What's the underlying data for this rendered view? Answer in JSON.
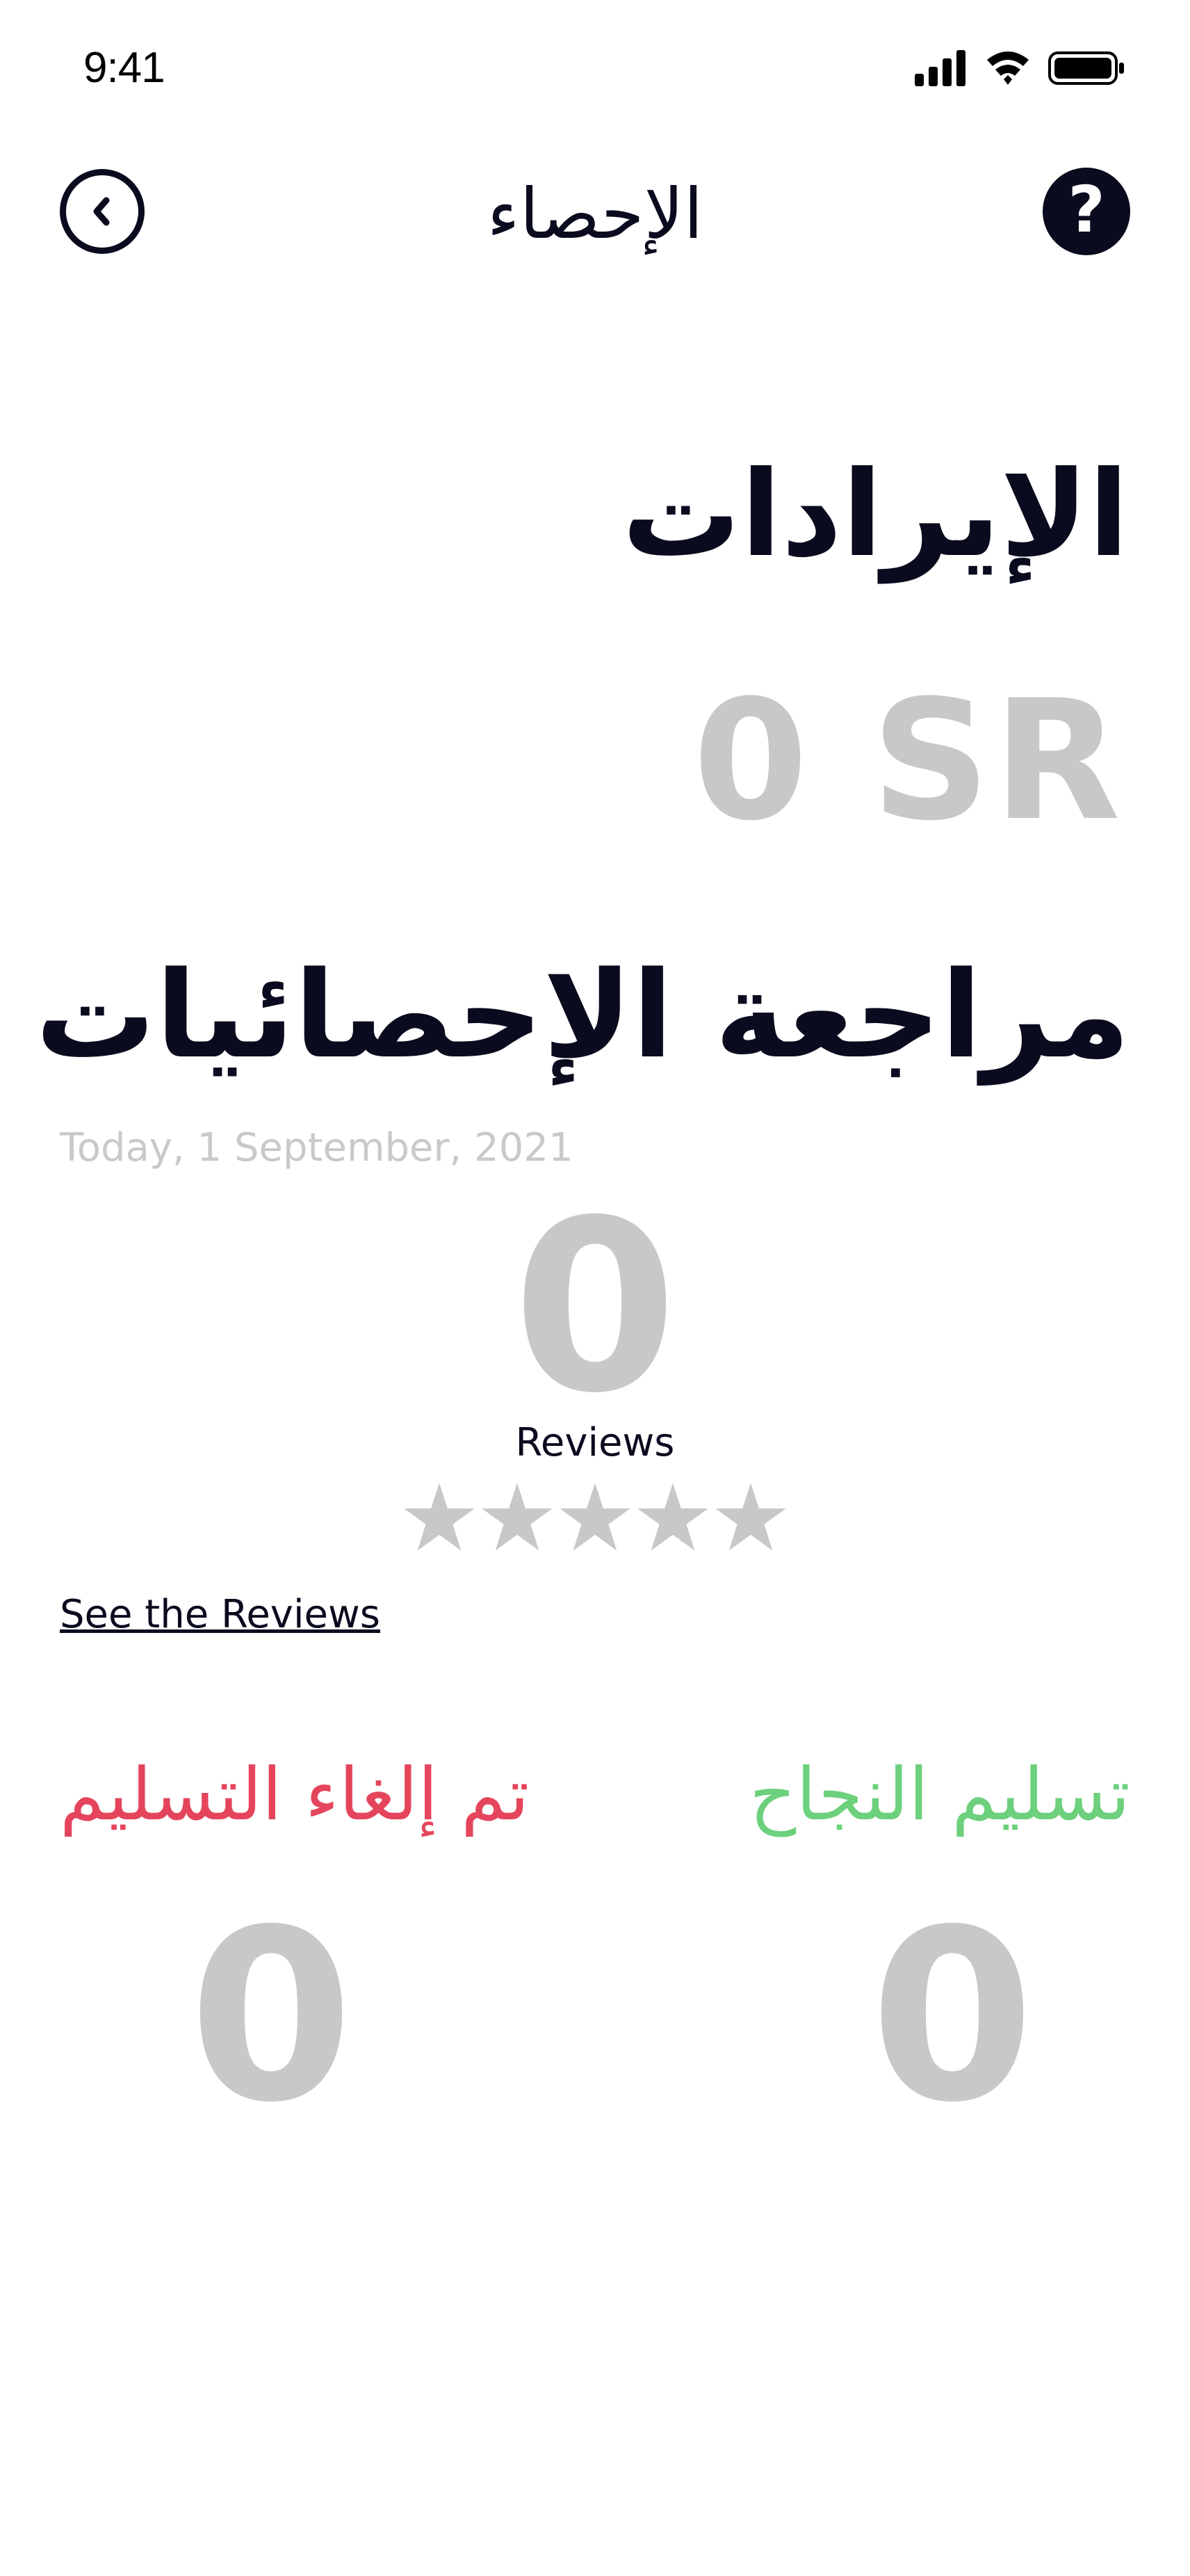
{
  "status_bar": {
    "time": "9:41",
    "icons": [
      "signal-icon",
      "wifi-icon",
      "battery-icon"
    ]
  },
  "header": {
    "title": "الإحصاء",
    "back_icon": "chevron-left-icon",
    "help_icon": "question-mark-icon",
    "help_glyph": "?"
  },
  "revenue": {
    "title": "الإيرادات",
    "value": "0 SR"
  },
  "stats_review": {
    "title": "مراجعة الإحصائيات",
    "date": "Today, 1 September, 2021",
    "reviews_count": "0",
    "reviews_label": "Reviews",
    "rating": 0,
    "max_rating": 5,
    "link": "See the Reviews"
  },
  "delivery": {
    "cancelled_label": "تم إلغاء التسليم",
    "cancelled_count": "0",
    "success_label": "تسليم النجاح",
    "success_count": "0"
  },
  "colors": {
    "primary_text": "#0b0b1f",
    "muted_value": "#c8c8c8",
    "cancelled": "#e5455c",
    "success": "#6dd07c",
    "star_empty": "#c8c8c8"
  }
}
